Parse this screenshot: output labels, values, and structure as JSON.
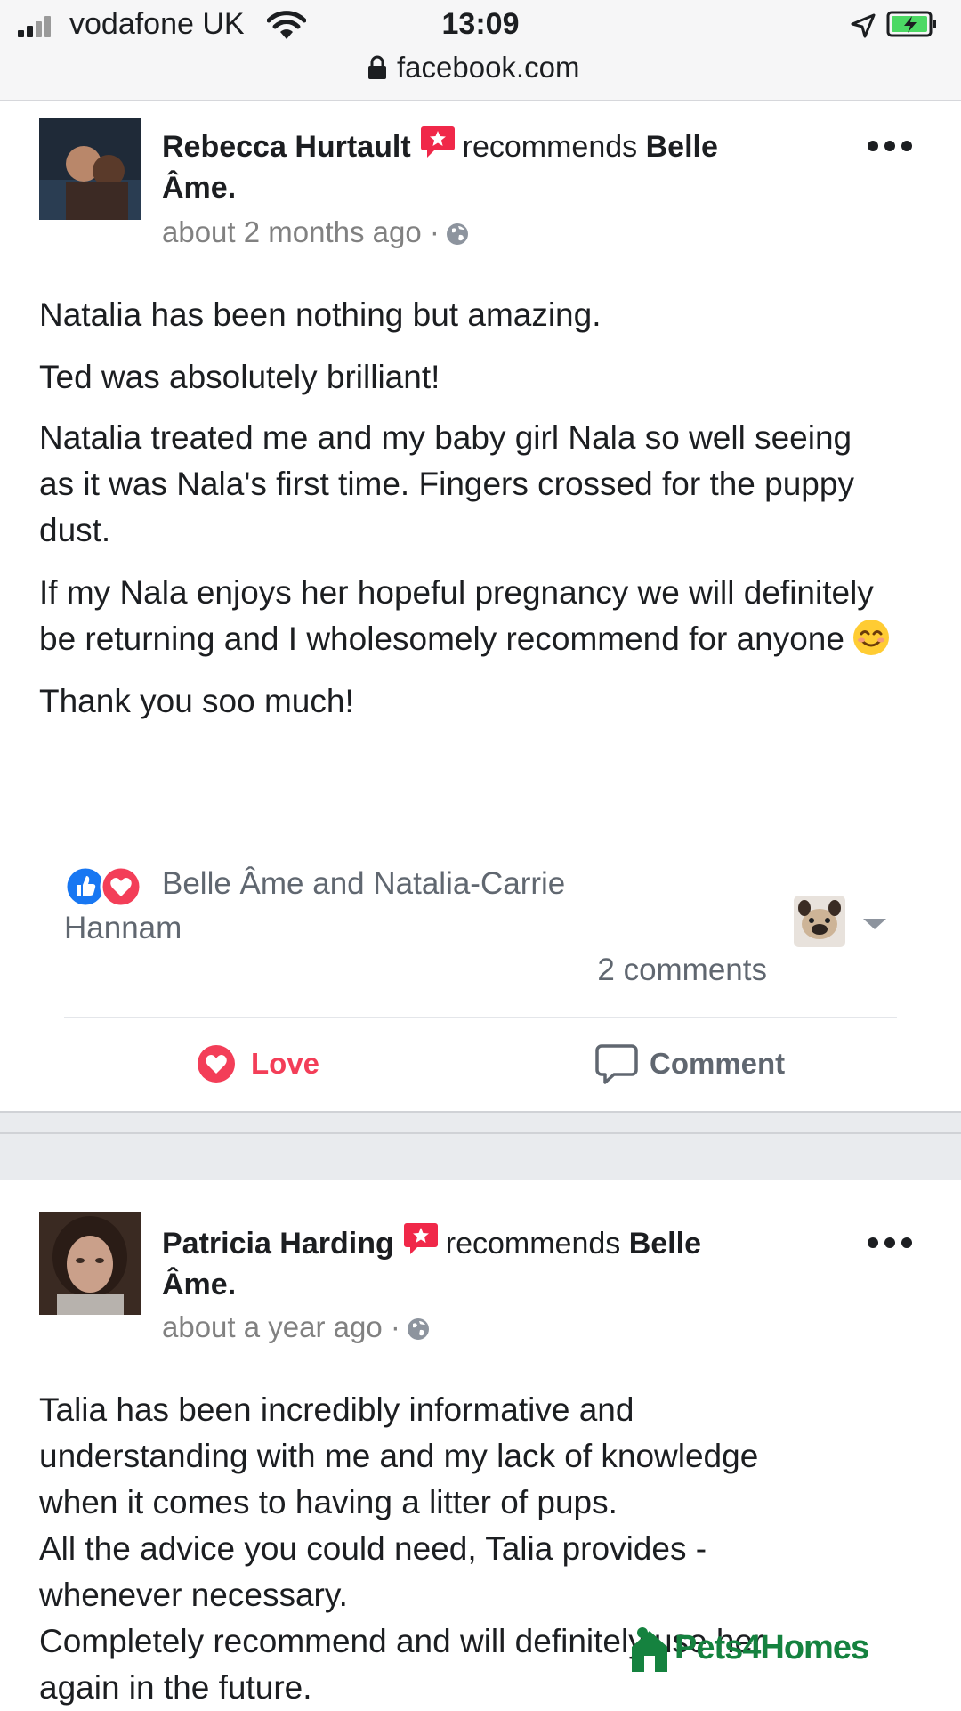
{
  "status_bar": {
    "carrier": "vodafone UK",
    "time": "13:09",
    "url": "facebook.com",
    "icons": [
      "signal-icon",
      "wifi-icon",
      "location-arrow-icon",
      "battery-charging-icon",
      "lock-icon"
    ]
  },
  "posts": [
    {
      "author": "Rebecca Hurtault",
      "verb": "recommends",
      "page": "Belle",
      "page_cont": "Âme.",
      "time": "about 2 months ago ·",
      "paragraphs": [
        "Natalia has been nothing but amazing.",
        "Ted was absolutely brilliant!",
        "Natalia treated me and my baby girl Nala so well seeing as it was Nala's first time. Fingers crossed for the puppy dust.",
        "If my Nala enjoys her hopeful pregnancy we will definitely be returning and I wholesomely recommend for anyone",
        "Thank you soo much!"
      ],
      "reactions_line1": "Belle Âme and Natalia-Carrie",
      "reactions_line2": "Hannam",
      "comments": "2 comments",
      "love_label": "Love",
      "comment_label": "Comment"
    },
    {
      "author": "Patricia Harding",
      "verb": "recommends",
      "page": "Belle",
      "page_cont": "Âme.",
      "time": "about a year ago ·",
      "lines": [
        "Talia has been incredibly informative and",
        "understanding with me and my lack of knowledge",
        "when it comes to having a litter of pups.",
        "All the advice you could need, Talia provides -",
        "whenever necessary.",
        "Completely recommend and will definitely use her",
        "again in the future."
      ]
    }
  ],
  "watermark": "Pets4Homes",
  "colors": {
    "love": "#f33e58",
    "like": "#1877f2",
    "meta_text": "#818181",
    "watermark": "#15823f"
  }
}
